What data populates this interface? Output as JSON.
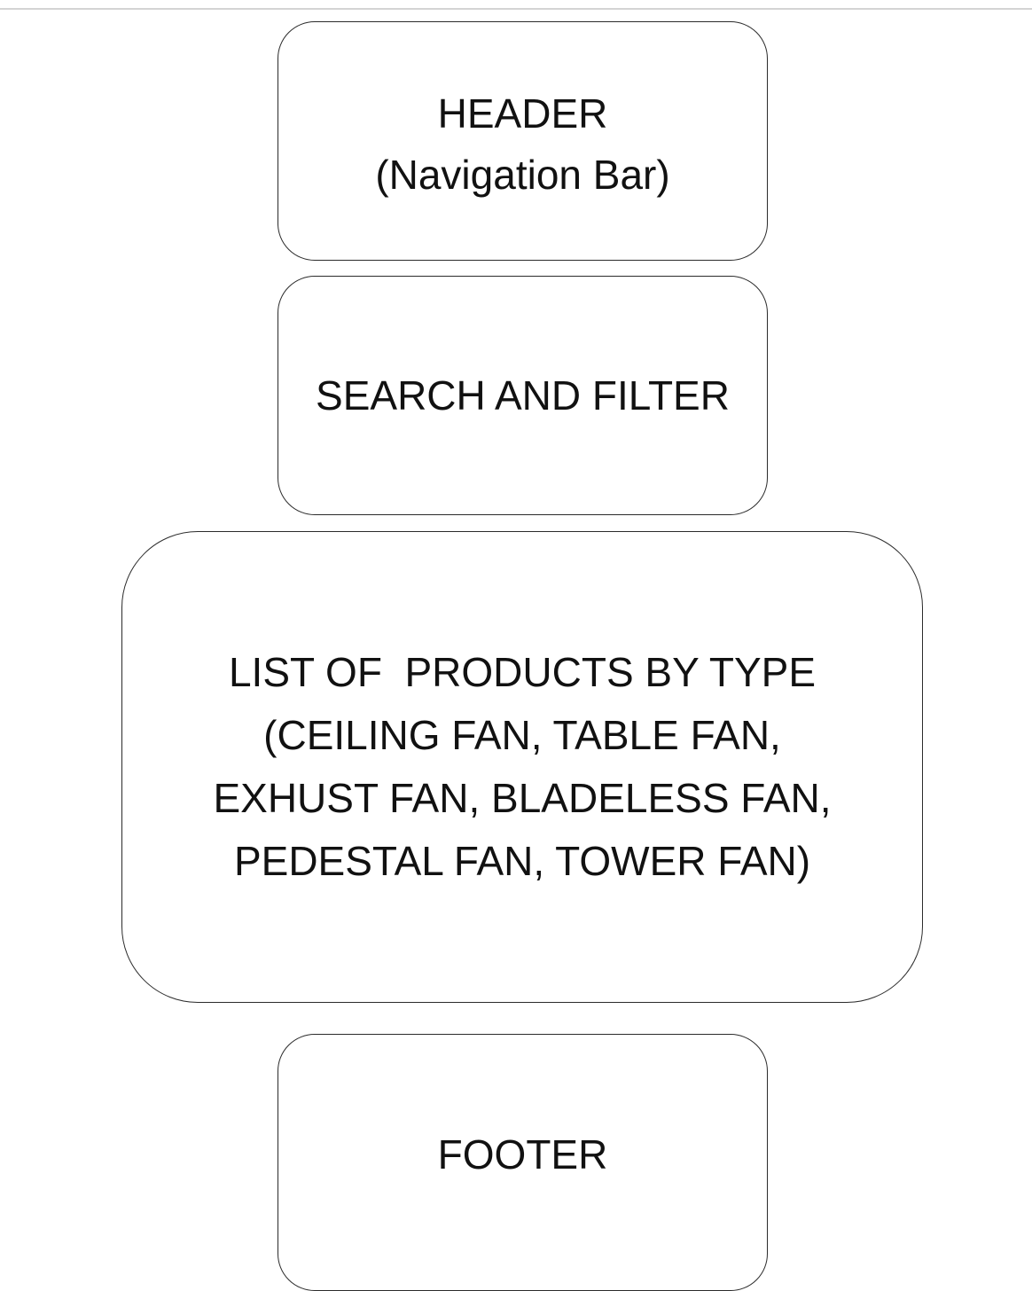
{
  "diagram": {
    "header_block": {
      "title": "HEADER",
      "subtitle": "(Navigation Bar)"
    },
    "search_block": {
      "title": "SEARCH AND FILTER"
    },
    "products_block": {
      "lines": [
        "LIST OF  PRODUCTS BY TYPE",
        "(CEILING FAN, TABLE FAN,",
        "EXHUST FAN, BLADELESS FAN,",
        "PEDESTAL FAN, TOWER FAN)"
      ]
    },
    "footer_block": {
      "title": "FOOTER"
    }
  },
  "colors": {
    "border": "#2b2b2b",
    "text": "#111111",
    "top_rule": "#d4d4d4",
    "background": "#ffffff"
  }
}
